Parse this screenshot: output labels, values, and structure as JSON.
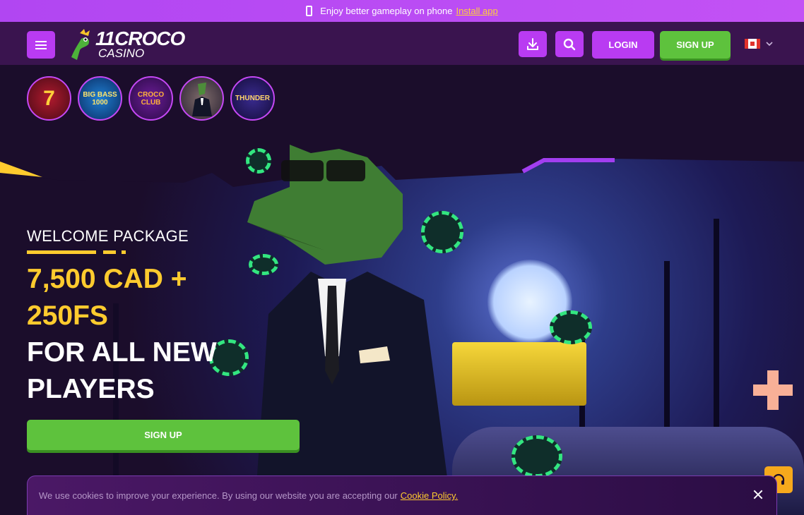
{
  "promo_bar": {
    "text": "Enjoy better gameplay on phone",
    "link": "Install app"
  },
  "header": {
    "logo_line1": "11CROCO",
    "logo_line2": "CASINO",
    "login_label": "LOGIN",
    "signup_label": "SIGN UP",
    "language": "CA"
  },
  "stories": [
    {
      "label": "7"
    },
    {
      "label": "BIG BASS 1000"
    },
    {
      "label": "CROCO CLUB"
    },
    {
      "label": ""
    },
    {
      "label": "THUNDER"
    }
  ],
  "hero": {
    "welcome": "WELCOME PACKAGE",
    "amount": "7,500 CAD + 250FS",
    "tagline": "FOR ALL NEW PLAYERS",
    "signup_label": "SIGN UP"
  },
  "cookie": {
    "text": "We use cookies to improve your experience. By using our website you are accepting our",
    "link": "Cookie Policy."
  },
  "colors": {
    "accent_purple": "#b93bf2",
    "signup_green": "#5ec23d",
    "gold": "#ffcb2e",
    "support_orange": "#f6a91c"
  },
  "icons": [
    "phone-icon",
    "menu-icon",
    "download-icon",
    "search-icon",
    "flag-canada-icon",
    "chevron-down-icon",
    "headset-icon",
    "close-icon"
  ]
}
